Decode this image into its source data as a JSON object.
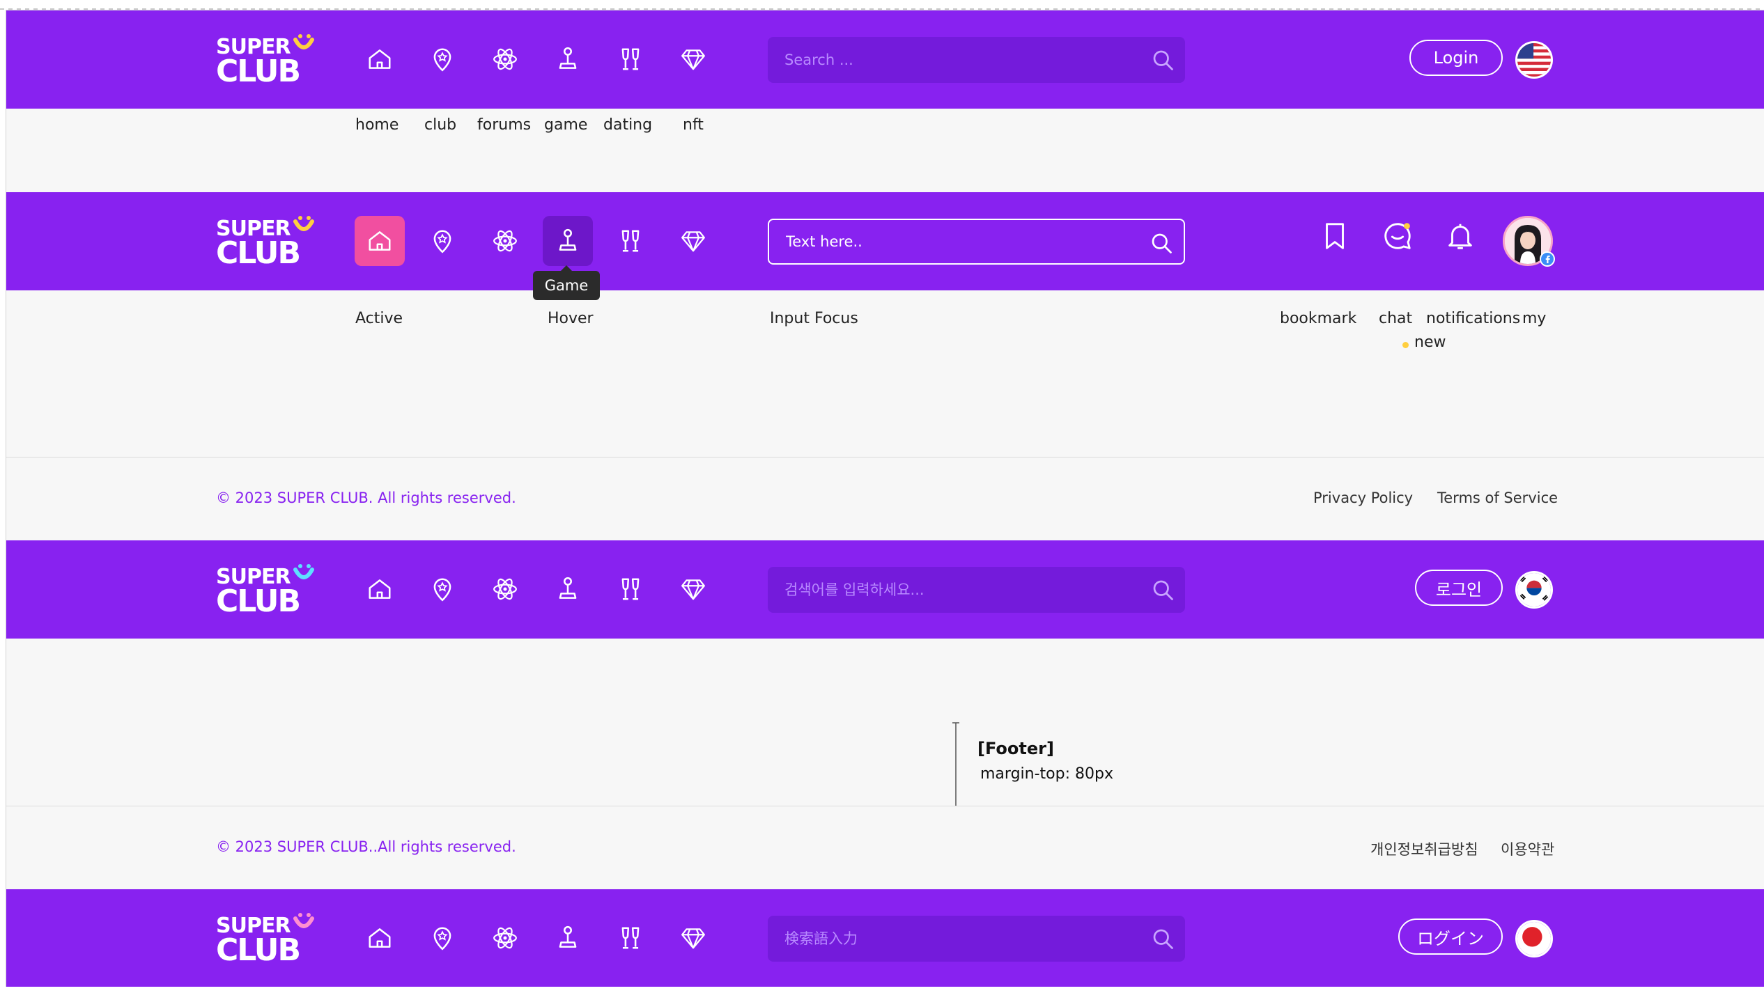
{
  "brand": {
    "logo_line1": "SUPER",
    "logo_line2": "CLUB"
  },
  "nav_items": [
    "home",
    "club",
    "forums",
    "game",
    "dating",
    "nft"
  ],
  "nav_icons": [
    "home-icon",
    "club-pin-icon",
    "forums-atom-icon",
    "game-joystick-icon",
    "dating-glasses-icon",
    "nft-diamond-icon"
  ],
  "header_en": {
    "search_placeholder": "Search ...",
    "login_label": "Login",
    "flag": "us-flag-icon"
  },
  "header_active": {
    "search_value": "Text here..",
    "tooltip": "Game"
  },
  "state_labels": {
    "active": "Active",
    "hover": "Hover",
    "input_focus": "Input Focus"
  },
  "user_labels": {
    "bookmark": "bookmark",
    "chat": "chat",
    "notifications": "notifications",
    "my": "my",
    "new": "new"
  },
  "footer_en": {
    "copyright": "© 2023 SUPER CLUB. All rights reserved.",
    "privacy": "Privacy Policy",
    "terms": "Terms of Service"
  },
  "header_ko": {
    "search_placeholder": "검색어를 입력하세요...",
    "login_label": "로그인",
    "flag": "korea-flag-icon"
  },
  "annotation": {
    "title": "[Footer]",
    "note": "margin-top: 80px"
  },
  "footer_ko": {
    "copyright": "© 2023 SUPER CLUB..All rights reserved.",
    "privacy": "개인정보취급방침",
    "terms": "이용약관"
  },
  "header_ja": {
    "search_placeholder": "検索語入力",
    "login_label": "ログイン",
    "flag": "japan-flag-icon"
  },
  "colors": {
    "brand_purple": "#8822f0",
    "search_bg": "#741bdb",
    "active_pink": "#f14fa0",
    "smile_yellow": "#ffcf3f",
    "smile_pink": "#ff8fd0",
    "smile_cyan": "#5ee0ff"
  }
}
